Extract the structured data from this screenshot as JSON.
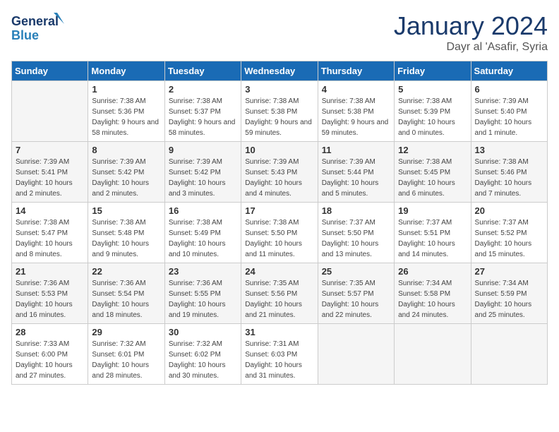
{
  "header": {
    "logo_line1": "General",
    "logo_line2": "Blue",
    "month": "January 2024",
    "location": "Dayr al 'Asafir, Syria"
  },
  "days_of_week": [
    "Sunday",
    "Monday",
    "Tuesday",
    "Wednesday",
    "Thursday",
    "Friday",
    "Saturday"
  ],
  "weeks": [
    [
      {
        "day": "",
        "sunrise": "",
        "sunset": "",
        "daylight": ""
      },
      {
        "day": "1",
        "sunrise": "Sunrise: 7:38 AM",
        "sunset": "Sunset: 5:36 PM",
        "daylight": "Daylight: 9 hours and 58 minutes."
      },
      {
        "day": "2",
        "sunrise": "Sunrise: 7:38 AM",
        "sunset": "Sunset: 5:37 PM",
        "daylight": "Daylight: 9 hours and 58 minutes."
      },
      {
        "day": "3",
        "sunrise": "Sunrise: 7:38 AM",
        "sunset": "Sunset: 5:38 PM",
        "daylight": "Daylight: 9 hours and 59 minutes."
      },
      {
        "day": "4",
        "sunrise": "Sunrise: 7:38 AM",
        "sunset": "Sunset: 5:38 PM",
        "daylight": "Daylight: 9 hours and 59 minutes."
      },
      {
        "day": "5",
        "sunrise": "Sunrise: 7:38 AM",
        "sunset": "Sunset: 5:39 PM",
        "daylight": "Daylight: 10 hours and 0 minutes."
      },
      {
        "day": "6",
        "sunrise": "Sunrise: 7:39 AM",
        "sunset": "Sunset: 5:40 PM",
        "daylight": "Daylight: 10 hours and 1 minute."
      }
    ],
    [
      {
        "day": "7",
        "sunrise": "Sunrise: 7:39 AM",
        "sunset": "Sunset: 5:41 PM",
        "daylight": "Daylight: 10 hours and 2 minutes."
      },
      {
        "day": "8",
        "sunrise": "Sunrise: 7:39 AM",
        "sunset": "Sunset: 5:42 PM",
        "daylight": "Daylight: 10 hours and 2 minutes."
      },
      {
        "day": "9",
        "sunrise": "Sunrise: 7:39 AM",
        "sunset": "Sunset: 5:42 PM",
        "daylight": "Daylight: 10 hours and 3 minutes."
      },
      {
        "day": "10",
        "sunrise": "Sunrise: 7:39 AM",
        "sunset": "Sunset: 5:43 PM",
        "daylight": "Daylight: 10 hours and 4 minutes."
      },
      {
        "day": "11",
        "sunrise": "Sunrise: 7:39 AM",
        "sunset": "Sunset: 5:44 PM",
        "daylight": "Daylight: 10 hours and 5 minutes."
      },
      {
        "day": "12",
        "sunrise": "Sunrise: 7:38 AM",
        "sunset": "Sunset: 5:45 PM",
        "daylight": "Daylight: 10 hours and 6 minutes."
      },
      {
        "day": "13",
        "sunrise": "Sunrise: 7:38 AM",
        "sunset": "Sunset: 5:46 PM",
        "daylight": "Daylight: 10 hours and 7 minutes."
      }
    ],
    [
      {
        "day": "14",
        "sunrise": "Sunrise: 7:38 AM",
        "sunset": "Sunset: 5:47 PM",
        "daylight": "Daylight: 10 hours and 8 minutes."
      },
      {
        "day": "15",
        "sunrise": "Sunrise: 7:38 AM",
        "sunset": "Sunset: 5:48 PM",
        "daylight": "Daylight: 10 hours and 9 minutes."
      },
      {
        "day": "16",
        "sunrise": "Sunrise: 7:38 AM",
        "sunset": "Sunset: 5:49 PM",
        "daylight": "Daylight: 10 hours and 10 minutes."
      },
      {
        "day": "17",
        "sunrise": "Sunrise: 7:38 AM",
        "sunset": "Sunset: 5:50 PM",
        "daylight": "Daylight: 10 hours and 11 minutes."
      },
      {
        "day": "18",
        "sunrise": "Sunrise: 7:37 AM",
        "sunset": "Sunset: 5:50 PM",
        "daylight": "Daylight: 10 hours and 13 minutes."
      },
      {
        "day": "19",
        "sunrise": "Sunrise: 7:37 AM",
        "sunset": "Sunset: 5:51 PM",
        "daylight": "Daylight: 10 hours and 14 minutes."
      },
      {
        "day": "20",
        "sunrise": "Sunrise: 7:37 AM",
        "sunset": "Sunset: 5:52 PM",
        "daylight": "Daylight: 10 hours and 15 minutes."
      }
    ],
    [
      {
        "day": "21",
        "sunrise": "Sunrise: 7:36 AM",
        "sunset": "Sunset: 5:53 PM",
        "daylight": "Daylight: 10 hours and 16 minutes."
      },
      {
        "day": "22",
        "sunrise": "Sunrise: 7:36 AM",
        "sunset": "Sunset: 5:54 PM",
        "daylight": "Daylight: 10 hours and 18 minutes."
      },
      {
        "day": "23",
        "sunrise": "Sunrise: 7:36 AM",
        "sunset": "Sunset: 5:55 PM",
        "daylight": "Daylight: 10 hours and 19 minutes."
      },
      {
        "day": "24",
        "sunrise": "Sunrise: 7:35 AM",
        "sunset": "Sunset: 5:56 PM",
        "daylight": "Daylight: 10 hours and 21 minutes."
      },
      {
        "day": "25",
        "sunrise": "Sunrise: 7:35 AM",
        "sunset": "Sunset: 5:57 PM",
        "daylight": "Daylight: 10 hours and 22 minutes."
      },
      {
        "day": "26",
        "sunrise": "Sunrise: 7:34 AM",
        "sunset": "Sunset: 5:58 PM",
        "daylight": "Daylight: 10 hours and 24 minutes."
      },
      {
        "day": "27",
        "sunrise": "Sunrise: 7:34 AM",
        "sunset": "Sunset: 5:59 PM",
        "daylight": "Daylight: 10 hours and 25 minutes."
      }
    ],
    [
      {
        "day": "28",
        "sunrise": "Sunrise: 7:33 AM",
        "sunset": "Sunset: 6:00 PM",
        "daylight": "Daylight: 10 hours and 27 minutes."
      },
      {
        "day": "29",
        "sunrise": "Sunrise: 7:32 AM",
        "sunset": "Sunset: 6:01 PM",
        "daylight": "Daylight: 10 hours and 28 minutes."
      },
      {
        "day": "30",
        "sunrise": "Sunrise: 7:32 AM",
        "sunset": "Sunset: 6:02 PM",
        "daylight": "Daylight: 10 hours and 30 minutes."
      },
      {
        "day": "31",
        "sunrise": "Sunrise: 7:31 AM",
        "sunset": "Sunset: 6:03 PM",
        "daylight": "Daylight: 10 hours and 31 minutes."
      },
      {
        "day": "",
        "sunrise": "",
        "sunset": "",
        "daylight": ""
      },
      {
        "day": "",
        "sunrise": "",
        "sunset": "",
        "daylight": ""
      },
      {
        "day": "",
        "sunrise": "",
        "sunset": "",
        "daylight": ""
      }
    ]
  ]
}
